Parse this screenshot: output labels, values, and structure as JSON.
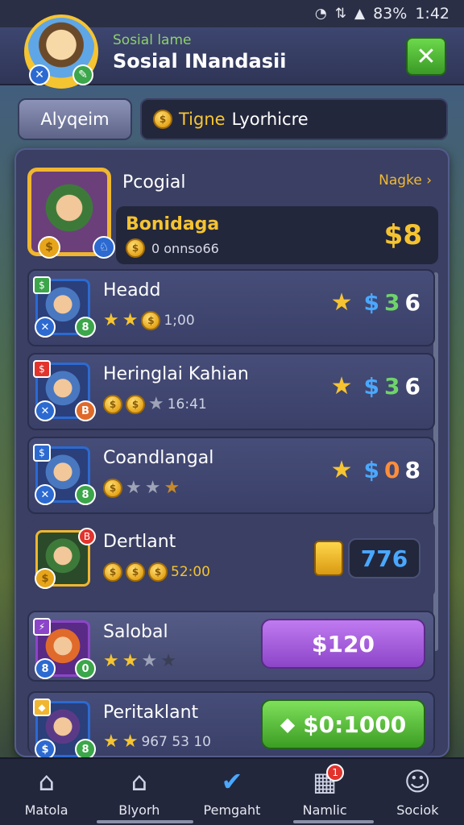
{
  "status": {
    "percent": "83%",
    "time": "1:42",
    "wifi_icon": "wifi-icon",
    "signal_icon": "signal-icon"
  },
  "header": {
    "subtitle": "Sosial lame",
    "title": "Sosial INandasii",
    "close_icon": "close-icon",
    "avatar_badge_left_icon": "shield-icon",
    "avatar_badge_right_icon": "sword-icon"
  },
  "tabs": {
    "left_label": "Alyqeim",
    "right_label_prefix": "Tigne",
    "right_label_rest": "Lyorhicre"
  },
  "featured": {
    "name": "Pcogial",
    "link_label": "Nagke",
    "gold_name": "Bonidaga",
    "sub_text": "0 onnso66",
    "price": "$8",
    "badge_coin": "$",
    "badge_right": "♘"
  },
  "items": [
    {
      "name": "Headd",
      "meta": "1;00",
      "stars": 2,
      "price_parts": [
        "$",
        "3",
        "6"
      ],
      "tag": "$",
      "tag_color": "#3ba64a",
      "bl": "✕",
      "br": "8"
    },
    {
      "name": "Heringlai Kahian",
      "meta": "16:41",
      "stars": 0,
      "price_parts": [
        "$",
        "3",
        "6"
      ],
      "tag": "$",
      "tag_color": "#e2332d",
      "bl": "✕",
      "br": "B"
    },
    {
      "name": "Coandlangal",
      "meta": "",
      "stars": 0,
      "price_parts": [
        "$",
        "0",
        "8"
      ],
      "tag": "$",
      "tag_color": "#2c6ad1",
      "bl": "✕",
      "br": "8"
    },
    {
      "name": "Dertlant",
      "meta": "52:00",
      "stars": 0,
      "price": "776",
      "tag": "B",
      "tag_color": "#e2332d"
    },
    {
      "name": "Salobal",
      "stars": 2,
      "buy": "$120",
      "tag": "⚡",
      "tag_color": "#8c45c8",
      "bl": "8",
      "br": "0"
    },
    {
      "name": "Peritaklant",
      "meta": "967 53 10",
      "stars": 2,
      "buy": "$0:1000",
      "tag": "◆",
      "tag_color": "#f0b630",
      "bl": "$",
      "br": "8"
    }
  ],
  "nav": [
    {
      "label": "Matola",
      "icon": "home-icon",
      "glyph": "⌂"
    },
    {
      "label": "Blyorh",
      "icon": "house-outline-icon",
      "glyph": "⌂"
    },
    {
      "label": "Pemgaht",
      "icon": "check-circle-icon",
      "glyph": "✔",
      "active": true
    },
    {
      "label": "Namlic",
      "icon": "calendar-icon",
      "glyph": "▦",
      "badge": "1"
    },
    {
      "label": "Sociok",
      "icon": "person-icon",
      "glyph": "☺"
    }
  ],
  "colors": {
    "gold": "#f5c331",
    "blue": "#4aa8ff",
    "green": "#6fd36a",
    "purple": "#8c45c8",
    "panel": "#3a3f63"
  }
}
